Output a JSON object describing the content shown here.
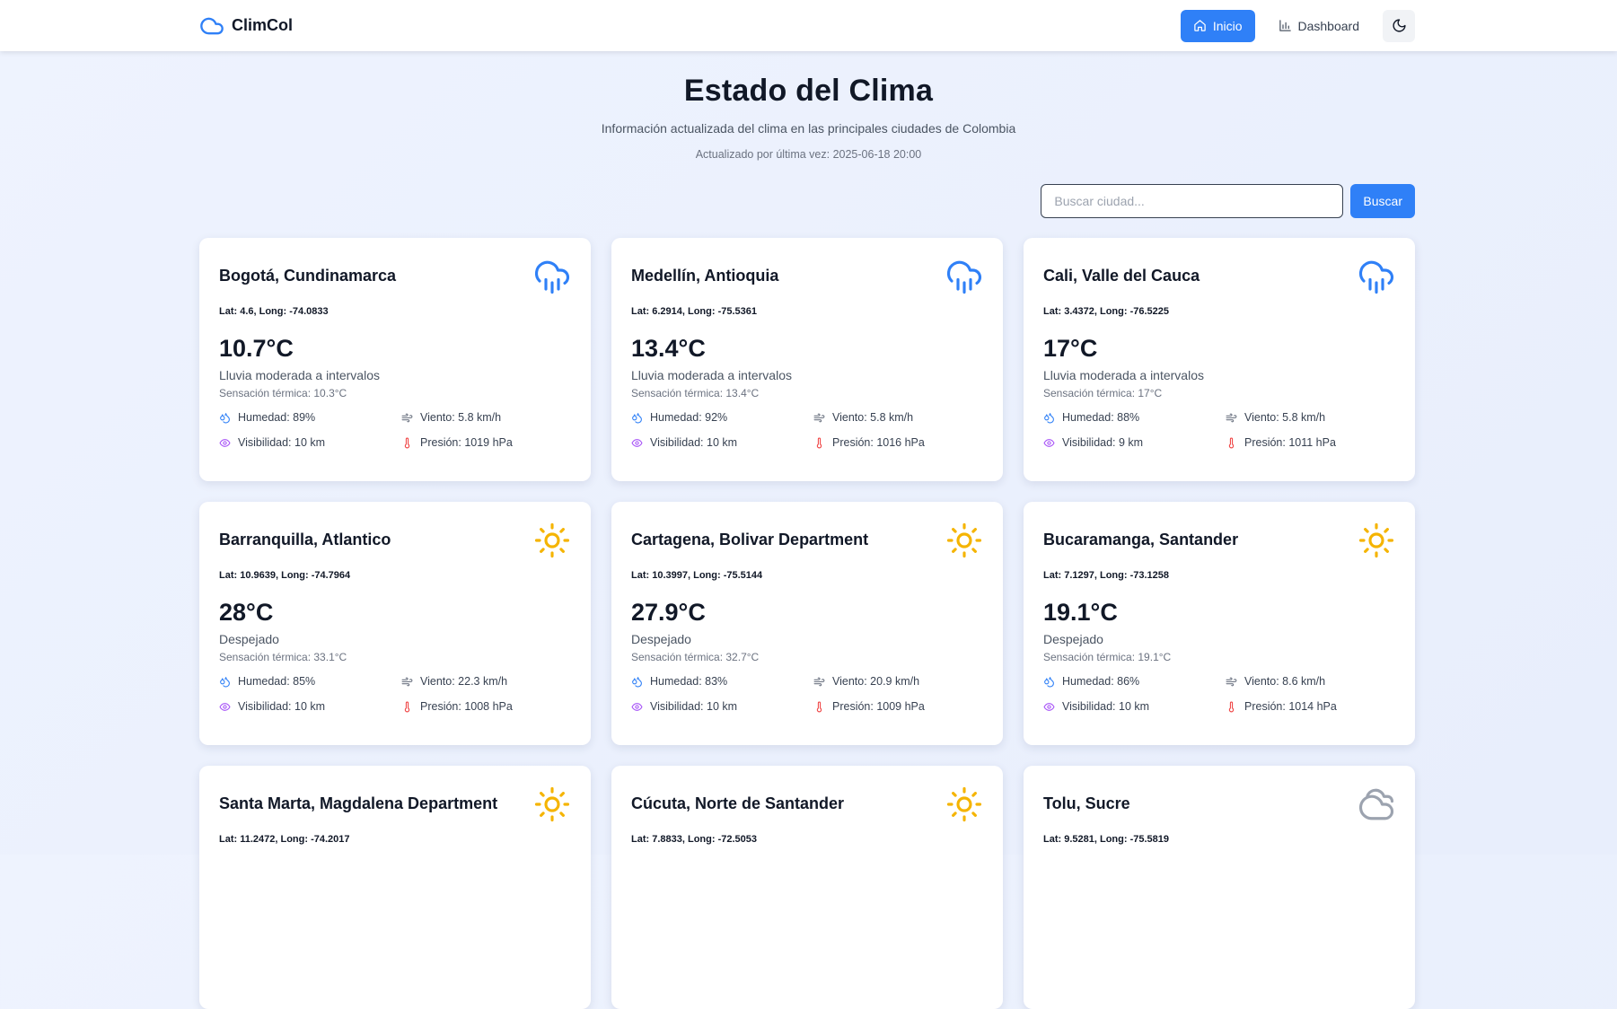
{
  "nav": {
    "brand": "ClimCol",
    "inicio": "Inicio",
    "dashboard": "Dashboard"
  },
  "header": {
    "title": "Estado del Clima",
    "subtitle": "Información actualizada del clima en las principales ciudades de Colombia",
    "updated": "Actualizado por última vez: 2025-06-18 20:00"
  },
  "search": {
    "placeholder": "Buscar ciudad...",
    "button": "Buscar"
  },
  "colors": {
    "accent": "#2f80f7",
    "rain_icon": "#2f80f7",
    "sun_icon": "#f5b400",
    "cloud_icon": "#9ca3af",
    "humidity_icon": "#2f80f7",
    "wind_icon": "#6b7280",
    "visibility_icon": "#a855f7",
    "pressure_icon": "#ef4444"
  },
  "cities": [
    {
      "name": "Bogotá, Cundinamarca",
      "icon": "rain-cloud-icon",
      "coords": "Lat: 4.6, Long: -74.0833",
      "temp": "10.7°C",
      "condition": "Lluvia moderada a intervalos",
      "feels": "Sensación térmica: 10.3°C",
      "humidity": "Humedad: 89%",
      "wind": "Viento: 5.8 km/h",
      "visibility": "Visibilidad: 10 km",
      "pressure": "Presión: 1019 hPa"
    },
    {
      "name": "Medellín, Antioquia",
      "icon": "rain-cloud-icon",
      "coords": "Lat: 6.2914, Long: -75.5361",
      "temp": "13.4°C",
      "condition": "Lluvia moderada a intervalos",
      "feels": "Sensación térmica: 13.4°C",
      "humidity": "Humedad: 92%",
      "wind": "Viento: 5.8 km/h",
      "visibility": "Visibilidad: 10 km",
      "pressure": "Presión: 1016 hPa"
    },
    {
      "name": "Cali, Valle del Cauca",
      "icon": "rain-cloud-icon",
      "coords": "Lat: 3.4372, Long: -76.5225",
      "temp": "17°C",
      "condition": "Lluvia moderada a intervalos",
      "feels": "Sensación térmica: 17°C",
      "humidity": "Humedad: 88%",
      "wind": "Viento: 5.8 km/h",
      "visibility": "Visibilidad: 9 km",
      "pressure": "Presión: 1011 hPa"
    },
    {
      "name": "Barranquilla, Atlantico",
      "icon": "sun-icon",
      "coords": "Lat: 10.9639, Long: -74.7964",
      "temp": "28°C",
      "condition": "Despejado",
      "feels": "Sensación térmica: 33.1°C",
      "humidity": "Humedad: 85%",
      "wind": "Viento: 22.3 km/h",
      "visibility": "Visibilidad: 10 km",
      "pressure": "Presión: 1008 hPa"
    },
    {
      "name": "Cartagena, Bolivar Department",
      "icon": "sun-icon",
      "coords": "Lat: 10.3997, Long: -75.5144",
      "temp": "27.9°C",
      "condition": "Despejado",
      "feels": "Sensación térmica: 32.7°C",
      "humidity": "Humedad: 83%",
      "wind": "Viento: 20.9 km/h",
      "visibility": "Visibilidad: 10 km",
      "pressure": "Presión: 1009 hPa"
    },
    {
      "name": "Bucaramanga, Santander",
      "icon": "sun-icon",
      "coords": "Lat: 7.1297, Long: -73.1258",
      "temp": "19.1°C",
      "condition": "Despejado",
      "feels": "Sensación térmica: 19.1°C",
      "humidity": "Humedad: 86%",
      "wind": "Viento: 8.6 km/h",
      "visibility": "Visibilidad: 10 km",
      "pressure": "Presión: 1014 hPa"
    },
    {
      "name": "Santa Marta, Magdalena Department",
      "icon": "sun-icon",
      "coords": "Lat: 11.2472, Long: -74.2017"
    },
    {
      "name": "Cúcuta, Norte de Santander",
      "icon": "sun-icon",
      "coords": "Lat: 7.8833, Long: -72.5053"
    },
    {
      "name": "Tolu, Sucre",
      "icon": "cloud-icon",
      "coords": "Lat: 9.5281, Long: -75.5819"
    }
  ]
}
